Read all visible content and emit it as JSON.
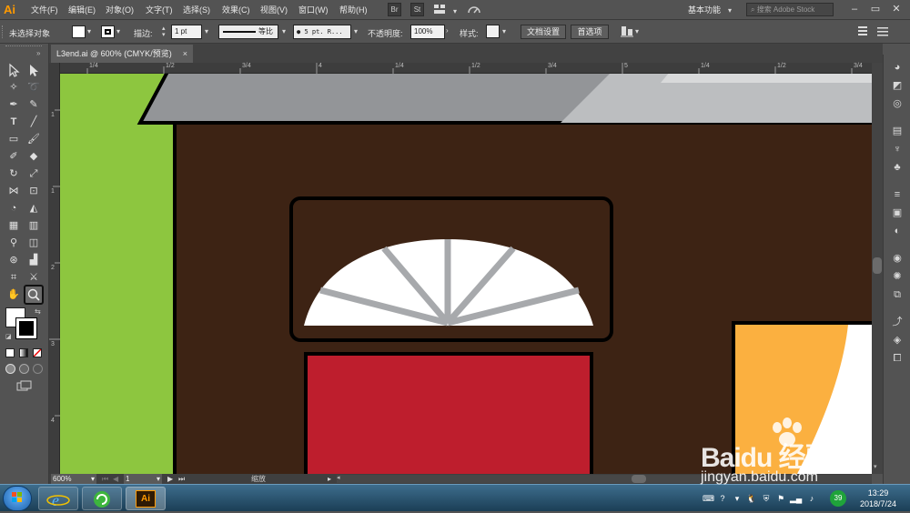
{
  "app": {
    "logo": "Ai"
  },
  "menu": {
    "items": [
      "文件(F)",
      "编辑(E)",
      "对象(O)",
      "文字(T)",
      "选择(S)",
      "效果(C)",
      "视图(V)",
      "窗口(W)",
      "帮助(H)"
    ],
    "bridge": "Br",
    "stock": "St",
    "workspace": "基本功能",
    "search_placeholder": "搜索 Adobe Stock"
  },
  "control": {
    "selection": "未选择对象",
    "stroke_label": "描边:",
    "stroke_weight": "1 pt",
    "stroke_profile": "等比",
    "brush": "5 pt. R...",
    "opacity_label": "不透明度:",
    "opacity": "100%",
    "style_label": "样式:",
    "doc_setup": "文档设置",
    "preferences": "首选项"
  },
  "tab": {
    "title": "L3end.ai @ 600% (CMYK/预览)",
    "close": "×"
  },
  "rulers": {
    "top": [
      "1/4",
      "1/2",
      "3/4",
      "4",
      "1/4",
      "1/2",
      "3/4",
      "5",
      "1/4",
      "1/2",
      "3/4"
    ],
    "left": [
      "1",
      "1",
      "2",
      "3",
      "4"
    ]
  },
  "status": {
    "zoom": "600%",
    "page": "1",
    "text": "缩放"
  },
  "taskbar": {
    "ai_label": "Ai",
    "time": "13:29",
    "date": "2018/7/24",
    "badge": "39"
  },
  "watermark": {
    "line1": "Baidu 经验",
    "line2": "jingyan.baidu.com"
  },
  "colors": {
    "green": "#8dc63f",
    "roof": "#939598",
    "roof_light": "#bcbec0",
    "wall": "#3d2314",
    "door": "#be1e2d",
    "window_orange": "#fbb040",
    "spokes": "#a7a9ac"
  }
}
